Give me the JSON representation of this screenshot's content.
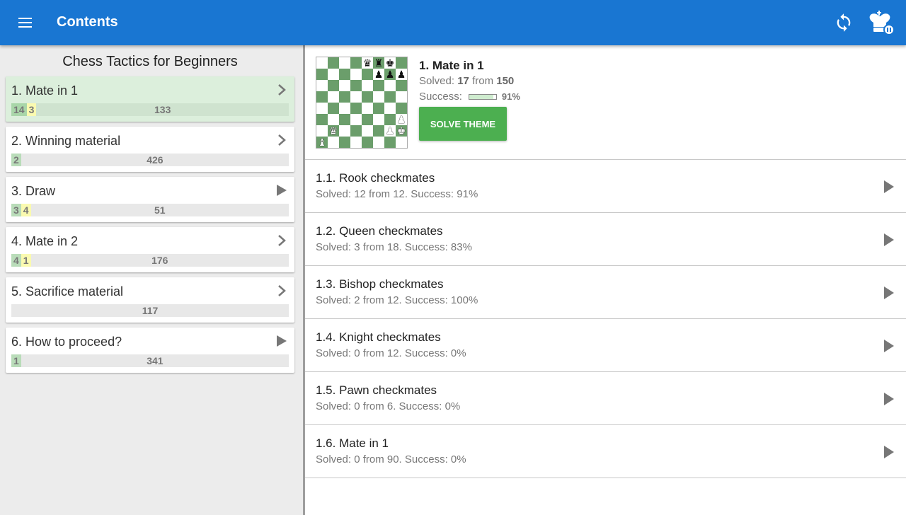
{
  "appbar": {
    "title": "Contents",
    "menu_icon": "hamburger-icon",
    "sync_icon": "sync-icon",
    "account_icon": "king-icon",
    "color": "#1976d2"
  },
  "book": {
    "title": "Chess Tactics for Beginners",
    "chapters": [
      {
        "label": "1. Mate in 1",
        "arrow": "chevron",
        "solved": "14",
        "failed": "3",
        "remaining": "133",
        "active": true
      },
      {
        "label": "2. Winning material",
        "arrow": "chevron",
        "solved": "2",
        "failed": "",
        "remaining": "426"
      },
      {
        "label": "3. Draw",
        "arrow": "play",
        "solved": "3",
        "failed": "4",
        "remaining": "51"
      },
      {
        "label": "4. Mate in 2",
        "arrow": "chevron",
        "solved": "4",
        "failed": "1",
        "remaining": "176"
      },
      {
        "label": "5. Sacrifice material",
        "arrow": "chevron",
        "solved": "",
        "failed": "",
        "remaining": "117"
      },
      {
        "label": "6. How to proceed?",
        "arrow": "play",
        "solved": "1",
        "failed": "",
        "remaining": "341"
      }
    ]
  },
  "theme": {
    "title": "1. Mate in 1",
    "solved_label": "Solved:",
    "solved": "17",
    "from_label": "from",
    "total": "150",
    "success_label": "Success:",
    "success_pct": "91%",
    "success_fraction": 0.91,
    "button": "SOLVE THEME",
    "board": [
      "....qrk.",
      ".....ppp",
      "........",
      "........",
      "........",
      ".......P",
      ".Q....PK",
      "B......."
    ]
  },
  "subthemes": [
    {
      "title": "1.1. Rook checkmates",
      "stats": "Solved: 12 from 12. Success: 91%"
    },
    {
      "title": "1.2. Queen checkmates",
      "stats": "Solved: 3 from 18. Success: 83%"
    },
    {
      "title": "1.3. Bishop checkmates",
      "stats": "Solved: 2 from 12. Success: 100%"
    },
    {
      "title": "1.4. Knight checkmates",
      "stats": "Solved: 0 from 12. Success: 0%"
    },
    {
      "title": "1.5. Pawn checkmates",
      "stats": "Solved: 0 from 6. Success: 0%"
    },
    {
      "title": "1.6. Mate in 1",
      "stats": "Solved: 0 from 90. Success: 0%"
    }
  ]
}
